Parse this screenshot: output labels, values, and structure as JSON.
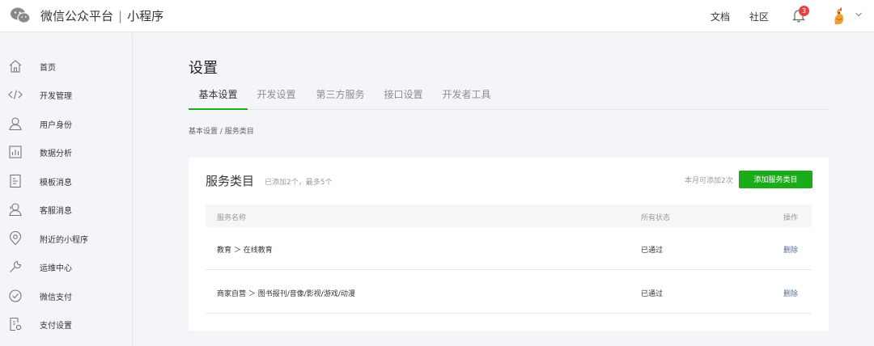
{
  "header": {
    "brand_title": "微信公众平台",
    "brand_sep": "|",
    "brand_sub": "小程序",
    "links": [
      {
        "label": "文档"
      },
      {
        "label": "社区"
      }
    ],
    "notifications": "3",
    "colors": {
      "accent": "#1aad19",
      "badge": "#e64340"
    }
  },
  "sidebar": {
    "items": [
      {
        "label": "首页",
        "icon": "home-icon"
      },
      {
        "label": "开发管理",
        "icon": "code-icon"
      },
      {
        "label": "用户身份",
        "icon": "user-icon"
      },
      {
        "label": "数据分析",
        "icon": "bar-chart-icon"
      },
      {
        "label": "模板消息",
        "icon": "document-icon"
      },
      {
        "label": "客服消息",
        "icon": "support-icon"
      },
      {
        "label": "附近的小程序",
        "icon": "location-icon"
      },
      {
        "label": "运维中心",
        "icon": "wrench-icon"
      },
      {
        "label": "微信支付",
        "icon": "payment-icon"
      },
      {
        "label": "支付设置",
        "icon": "payment-settings-icon"
      }
    ]
  },
  "main": {
    "title": "设置",
    "tabs": [
      {
        "label": "基本设置",
        "active": true
      },
      {
        "label": "开发设置"
      },
      {
        "label": "第三方服务"
      },
      {
        "label": "接口设置"
      },
      {
        "label": "开发者工具"
      }
    ],
    "breadcrumb": "基本设置 / 服务类目"
  },
  "card": {
    "title": "服务类目",
    "subtitle": "已添加2个，最多5个",
    "quota": "本月可添加2次",
    "add_button": "添加服务类目",
    "columns": [
      "服务名称",
      "所有状态",
      "操作"
    ],
    "rows": [
      {
        "name": "教育 ＞ 在线教育",
        "status": "已通过",
        "action": "删除"
      },
      {
        "name": "商家自营 ＞ 图书报刊/音像/影视/游戏/动漫",
        "status": "已通过",
        "action": "删除"
      }
    ]
  }
}
